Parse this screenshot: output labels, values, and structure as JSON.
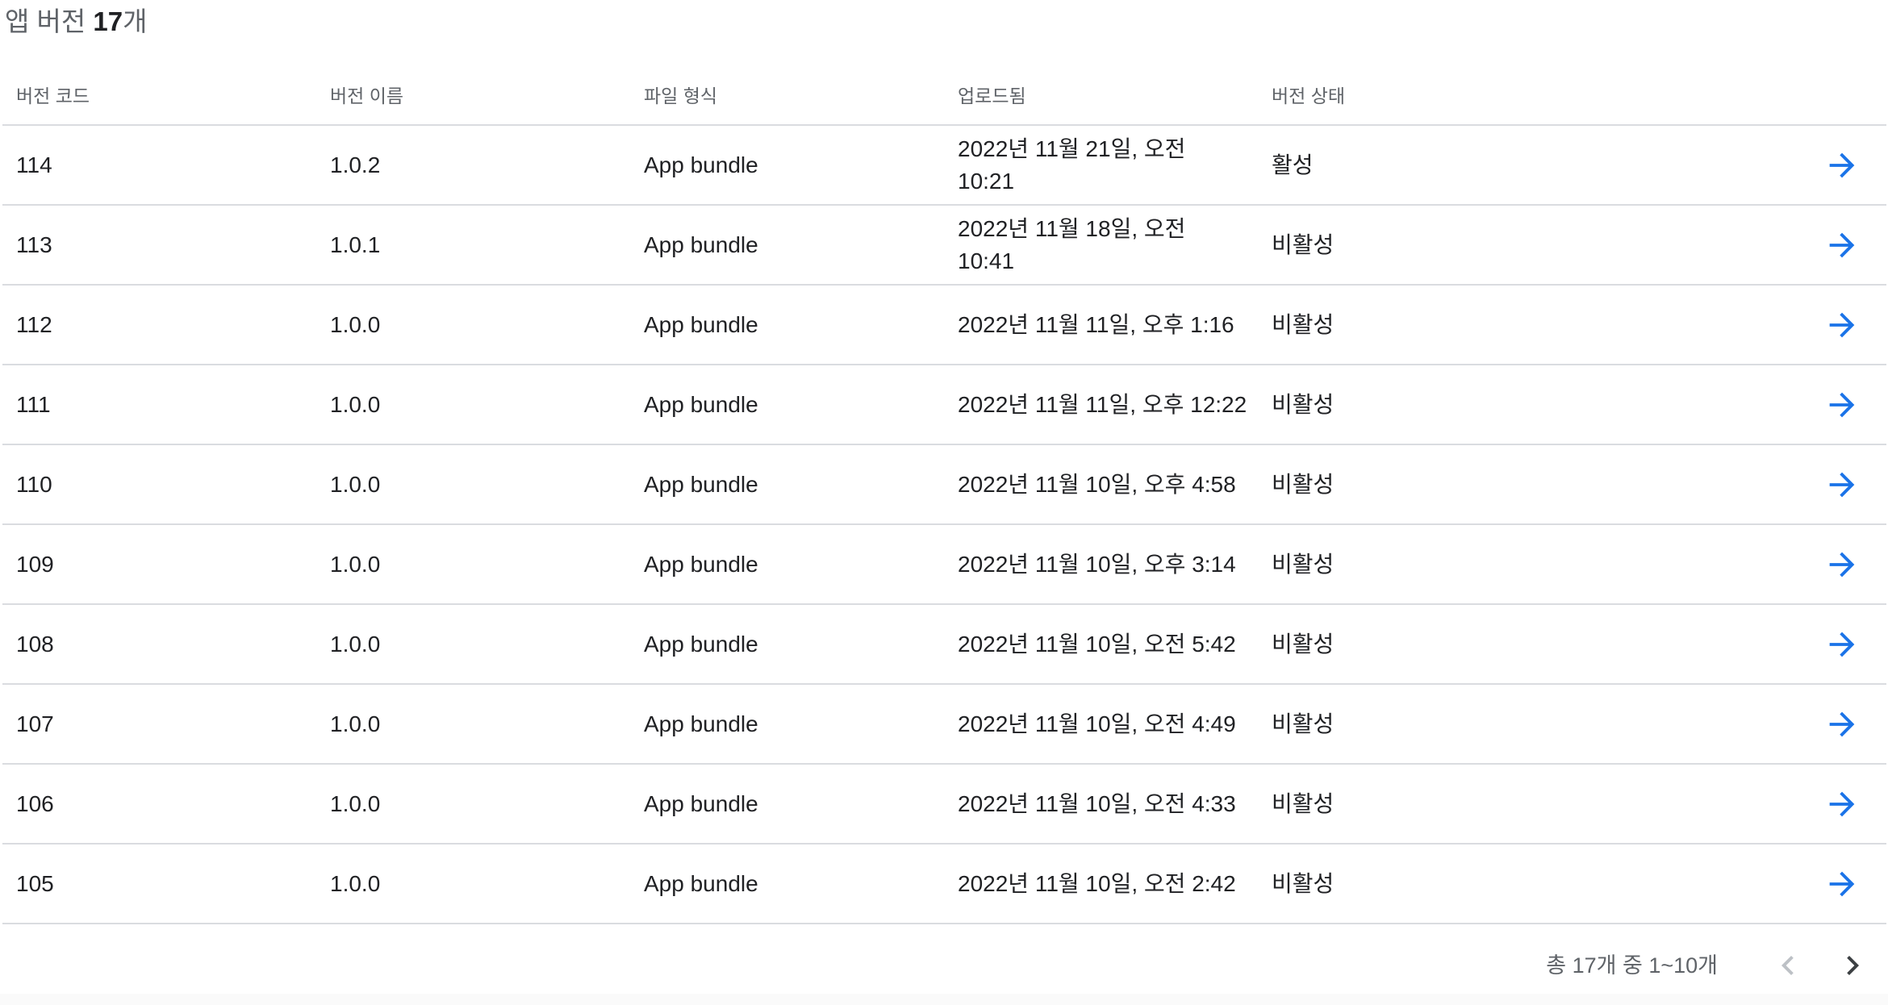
{
  "heading": {
    "prefix": "앱 버전 ",
    "count": "17",
    "suffix": "개"
  },
  "table": {
    "columns": [
      "버전 코드",
      "버전 이름",
      "파일 형식",
      "업로드됨",
      "버전 상태"
    ],
    "rows": [
      {
        "code": "114",
        "name": "1.0.2",
        "format": "App bundle",
        "uploaded": "2022년 11월 21일, 오전 10:21",
        "status": "활성"
      },
      {
        "code": "113",
        "name": "1.0.1",
        "format": "App bundle",
        "uploaded": "2022년 11월 18일, 오전 10:41",
        "status": "비활성"
      },
      {
        "code": "112",
        "name": "1.0.0",
        "format": "App bundle",
        "uploaded": "2022년 11월 11일, 오후 1:16",
        "status": "비활성"
      },
      {
        "code": "111",
        "name": "1.0.0",
        "format": "App bundle",
        "uploaded": "2022년 11월 11일, 오후 12:22",
        "status": "비활성"
      },
      {
        "code": "110",
        "name": "1.0.0",
        "format": "App bundle",
        "uploaded": "2022년 11월 10일, 오후 4:58",
        "status": "비활성"
      },
      {
        "code": "109",
        "name": "1.0.0",
        "format": "App bundle",
        "uploaded": "2022년 11월 10일, 오후 3:14",
        "status": "비활성"
      },
      {
        "code": "108",
        "name": "1.0.0",
        "format": "App bundle",
        "uploaded": "2022년 11월 10일, 오전 5:42",
        "status": "비활성"
      },
      {
        "code": "107",
        "name": "1.0.0",
        "format": "App bundle",
        "uploaded": "2022년 11월 10일, 오전 4:49",
        "status": "비활성"
      },
      {
        "code": "106",
        "name": "1.0.0",
        "format": "App bundle",
        "uploaded": "2022년 11월 10일, 오전 4:33",
        "status": "비활성"
      },
      {
        "code": "105",
        "name": "1.0.0",
        "format": "App bundle",
        "uploaded": "2022년 11월 10일, 오전 2:42",
        "status": "비활성"
      }
    ],
    "row_action_icon": "arrow-right-icon"
  },
  "pagination": {
    "range_text": "총 17개 중 1~10개",
    "prev_icon": "chevron-left-icon",
    "next_icon": "chevron-right-icon",
    "prev_enabled": false,
    "next_enabled": true
  },
  "colors": {
    "accent": "#1a73e8",
    "divider": "#dadce0",
    "secondary_text": "#5f6368",
    "primary_text": "#202124",
    "disabled": "#bdc1c6"
  }
}
